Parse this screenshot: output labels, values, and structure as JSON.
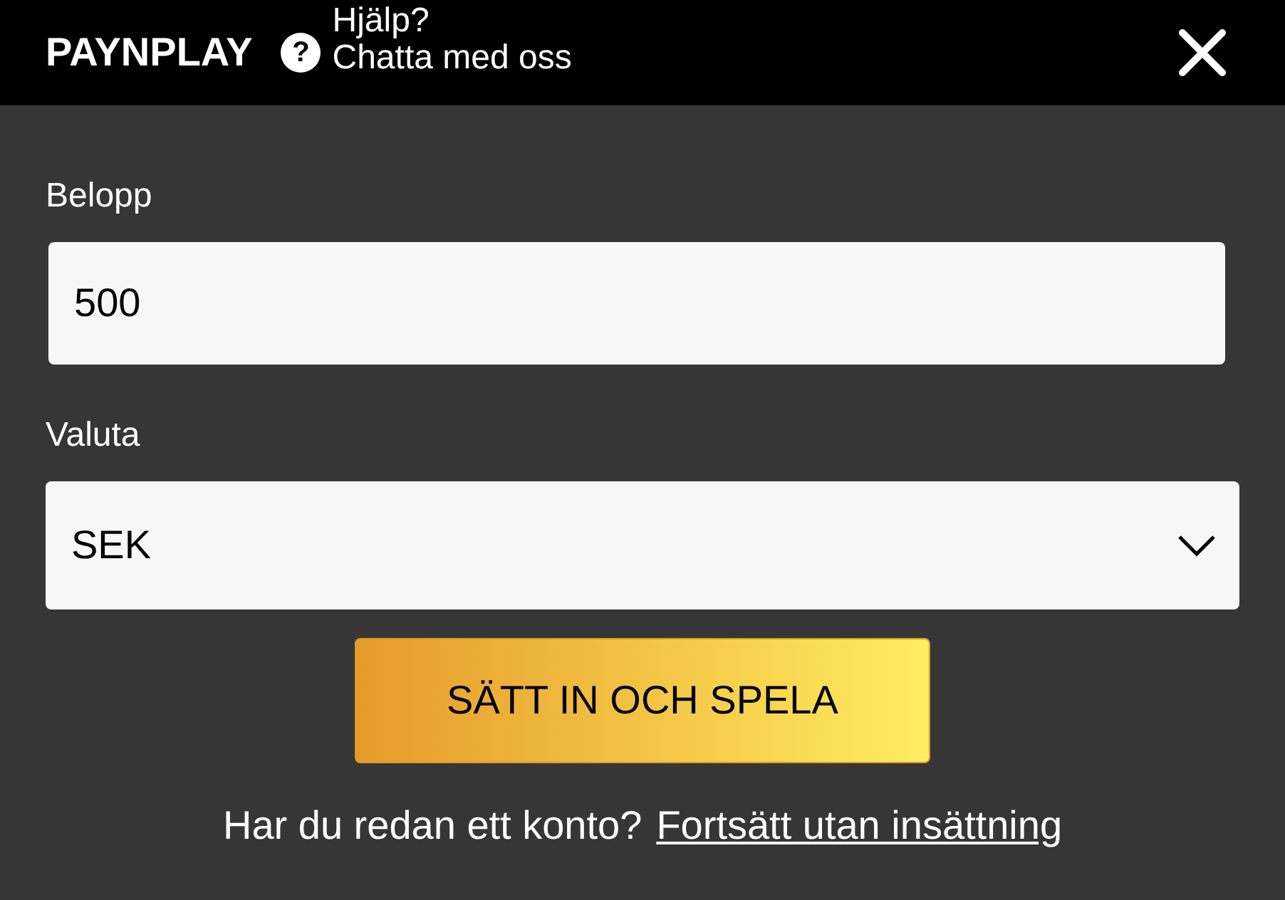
{
  "header": {
    "brand": "PAYNPLAY",
    "help_glyph": "?",
    "help_lines": [
      "Hjälp?",
      "Chatta med oss"
    ]
  },
  "amount": {
    "label": "Belopp",
    "value": "500"
  },
  "currency": {
    "label": "Valuta",
    "value": "SEK"
  },
  "submit": {
    "label": "SÄTT IN OCH SPELA"
  },
  "footer": {
    "text": "Har du redan ett konto?",
    "link": "Fortsätt utan insättning"
  }
}
